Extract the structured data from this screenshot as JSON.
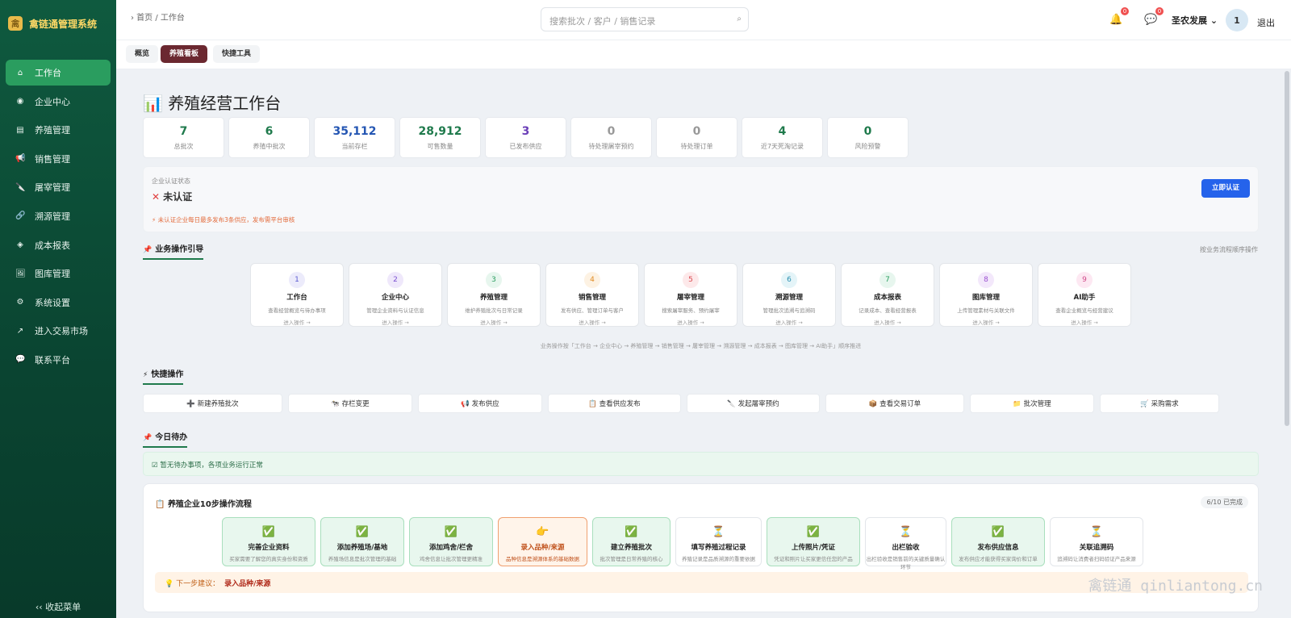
{
  "app": {
    "name": "禽链通管理系统",
    "logo_char": "禽"
  },
  "sidebar": {
    "items": [
      {
        "label": "工作台",
        "icon": "⌂"
      },
      {
        "label": "企业中心",
        "icon": "◉"
      },
      {
        "label": "养殖管理",
        "icon": "▤"
      },
      {
        "label": "销售管理",
        "icon": "📢"
      },
      {
        "label": "屠宰管理",
        "icon": "🔪"
      },
      {
        "label": "溯源管理",
        "icon": "🔗"
      },
      {
        "label": "成本报表",
        "icon": "◈"
      },
      {
        "label": "图库管理",
        "icon": "🖼"
      },
      {
        "label": "系统设置",
        "icon": "⚙"
      },
      {
        "label": "进入交易市场",
        "icon": "↗"
      },
      {
        "label": "联系平台",
        "icon": "💬"
      }
    ],
    "collapse_label": "‹‹ 收起菜单"
  },
  "topbar": {
    "breadcrumb": "› 首页 / 工作台",
    "search_placeholder": "搜索批次 / 客户 / 销售记录",
    "bell_count": "0",
    "chat_count": "0",
    "user_name": "圣农发展 ⌄",
    "avatar_text": "1",
    "logout": "退出"
  },
  "tabs": [
    "概览",
    "养殖看板",
    "快捷工具"
  ],
  "page_title": "养殖经营工作台",
  "stats": [
    {
      "value": "7",
      "label": "总批次",
      "color": "#1f7a4c"
    },
    {
      "value": "6",
      "label": "养殖中批次",
      "color": "#1f7a4c"
    },
    {
      "value": "35,112",
      "label": "当前存栏",
      "color": "#2456b3"
    },
    {
      "value": "28,912",
      "label": "可售数量",
      "color": "#1f7a4c"
    },
    {
      "value": "3",
      "label": "已发布供应",
      "color": "#6b3fb8"
    },
    {
      "value": "0",
      "label": "待处理屠宰预约",
      "color": "#999999"
    },
    {
      "value": "0",
      "label": "待处理订单",
      "color": "#999999"
    },
    {
      "value": "4",
      "label": "近7天死淘记录",
      "color": "#1f7a4c"
    },
    {
      "value": "0",
      "label": "风险预警",
      "color": "#1f7a4c"
    }
  ],
  "cert": {
    "title": "企业认证状态",
    "status": "未认证",
    "tip": "⚡ 未认证企业每日最多发布3条供应，发布需平台审核",
    "button": "立即认证"
  },
  "guide": {
    "title": "业务操作引导",
    "right_note": "按业务流程顺序操作",
    "action_text": "进入操作 →",
    "cards": [
      {
        "num": "1",
        "title": "工作台",
        "desc": "查看经营概览与待办事项",
        "bg": "#ecebfb",
        "fg": "#5a5ad0"
      },
      {
        "num": "2",
        "title": "企业中心",
        "desc": "管理企业资料与认证信息",
        "bg": "#efe8fb",
        "fg": "#7a4fd0"
      },
      {
        "num": "3",
        "title": "养殖管理",
        "desc": "维护养殖批次与日常记录",
        "bg": "#e7f6ee",
        "fg": "#2a9d5f"
      },
      {
        "num": "4",
        "title": "销售管理",
        "desc": "发布供应、管理订单与客户",
        "bg": "#fdf2e3",
        "fg": "#e08a20"
      },
      {
        "num": "5",
        "title": "屠宰管理",
        "desc": "搜索屠宰服务、预约屠宰",
        "bg": "#fde9ea",
        "fg": "#d94a50"
      },
      {
        "num": "6",
        "title": "溯源管理",
        "desc": "管理批次追溯与追溯码",
        "bg": "#e4f4f8",
        "fg": "#2a8fb0"
      },
      {
        "num": "7",
        "title": "成本报表",
        "desc": "记录成本、查看经营报表",
        "bg": "#e7f6ee",
        "fg": "#2a9d5f"
      },
      {
        "num": "8",
        "title": "图库管理",
        "desc": "上传管理素材与关联文件",
        "bg": "#f3e8fb",
        "fg": "#9a4fd0"
      },
      {
        "num": "9",
        "title": "AI助手",
        "desc": "查看企业概览与经营建议",
        "bg": "#fde8f2",
        "fg": "#d04a8a"
      }
    ],
    "flow_text": "业务操作按「工作台 → 企业中心 → 养殖管理 → 销售管理 → 屠宰管理 → 溯源管理 → 成本报表 → 图库管理 → AI助手」顺序推进"
  },
  "quick": {
    "title": "快捷操作",
    "items": [
      {
        "label": "➕ 新建养殖批次"
      },
      {
        "label": "🐄 存栏变更"
      },
      {
        "label": "📢 发布供应"
      },
      {
        "label": "📋 查看供应发布"
      },
      {
        "label": "🔪 发起屠宰预约"
      },
      {
        "label": "📦 查看交易订单"
      },
      {
        "label": "📁 批次管理"
      },
      {
        "label": "🛒 采购需求"
      }
    ]
  },
  "todo": {
    "title": "今日待办",
    "message": "☑ 暂无待办事项，各项业务运行正常"
  },
  "flow": {
    "title": "养殖企业10步操作流程",
    "progress": "6/10 已完成",
    "steps": [
      {
        "icon": "✅",
        "title": "完善企业资料",
        "desc": "买家需要了解您的真实身份和资质",
        "state": "done"
      },
      {
        "icon": "✅",
        "title": "添加养殖场/基地",
        "desc": "养殖场信息是批次管理的基础",
        "state": "done"
      },
      {
        "icon": "✅",
        "title": "添加鸡舍/栏舍",
        "desc": "鸡舍信息让批次管理更精准",
        "state": "done"
      },
      {
        "icon": "👉",
        "title": "录入品种/来源",
        "desc": "品种信息是溯源体系的基础数据",
        "state": "cur"
      },
      {
        "icon": "✅",
        "title": "建立养殖批次",
        "desc": "批次管理是日常养殖的核心",
        "state": "done"
      },
      {
        "icon": "⏳",
        "title": "填写养殖过程记录",
        "desc": "养殖记录是品质溯源的重要依据",
        "state": "todo"
      },
      {
        "icon": "✅",
        "title": "上传照片/凭证",
        "desc": "凭证和照片让买家更信任您的产品",
        "state": "done"
      },
      {
        "icon": "⏳",
        "title": "出栏验收",
        "desc": "出栏验收是销售前的关键质量确认环节",
        "state": "todo"
      },
      {
        "icon": "✅",
        "title": "发布供应信息",
        "desc": "发布供应才能获得买家询价和订单",
        "state": "done"
      },
      {
        "icon": "⏳",
        "title": "关联追溯码",
        "desc": "追溯码让消费者扫码验证产品来源",
        "state": "todo"
      }
    ],
    "next_label": "💡 下一步建议：",
    "next_value": "录入品种/来源"
  },
  "watermark": "禽链通 qinliantong.cn"
}
